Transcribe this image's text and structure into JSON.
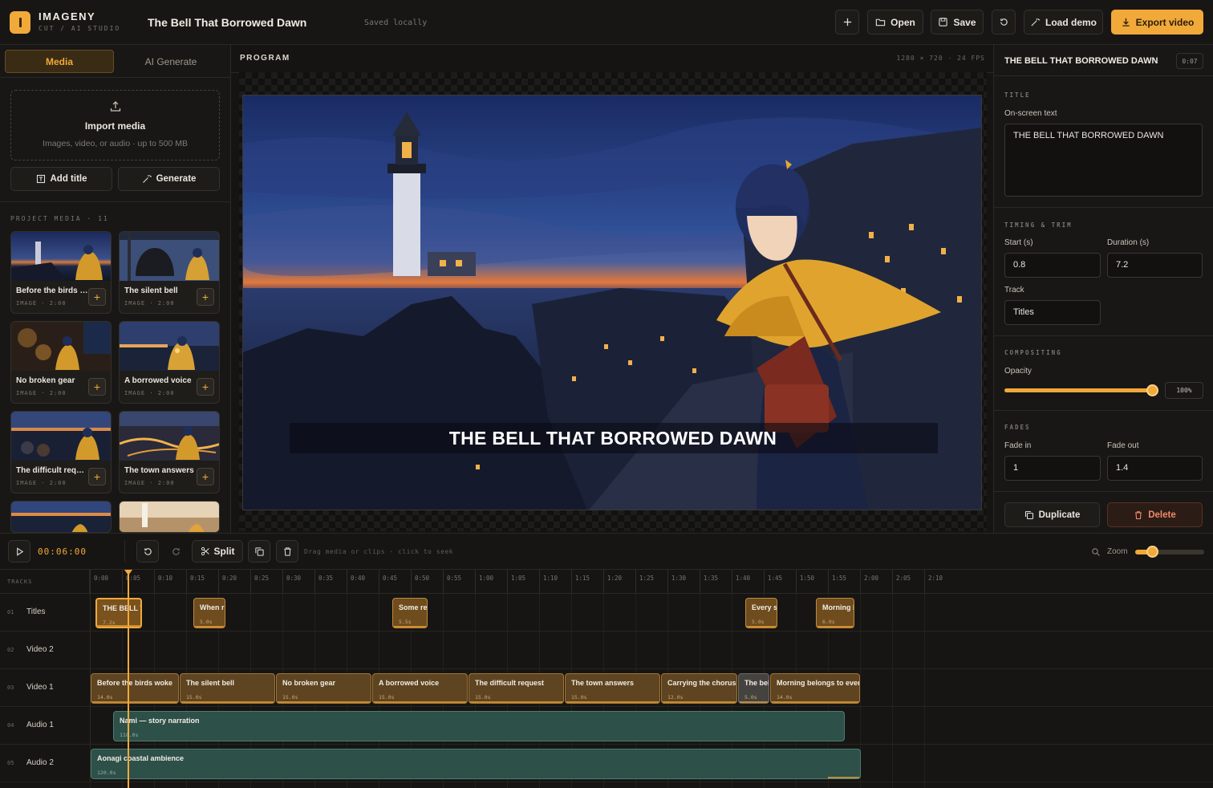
{
  "app": {
    "brand": "IMAGENY",
    "brand_sub": "CUT / AI STUDIO",
    "project_title": "The Bell That Borrowed Dawn",
    "save_status": "Saved locally"
  },
  "toolbar": {
    "open": "Open",
    "save": "Save",
    "load_demo": "Load demo",
    "export": "Export video"
  },
  "left": {
    "tabs": [
      "Media",
      "AI Generate"
    ],
    "import_title": "Import media",
    "import_sub": "Images, video, or audio · up to 500 MB",
    "add_title": "Add title",
    "generate": "Generate",
    "project_media_label": "PROJECT MEDIA · 11",
    "cards": [
      {
        "title": "Before the birds woke",
        "meta": "IMAGE · 2:00"
      },
      {
        "title": "The silent bell",
        "meta": "IMAGE · 2:00"
      },
      {
        "title": "No broken gear",
        "meta": "IMAGE · 2:00"
      },
      {
        "title": "A borrowed voice",
        "meta": "IMAGE · 2:00"
      },
      {
        "title": "The difficult request",
        "meta": "IMAGE · 2:00"
      },
      {
        "title": "The town answers",
        "meta": "IMAGE · 2:00"
      }
    ]
  },
  "program": {
    "label": "PROGRAM",
    "resolution": "1280 × 720 · 24 FPS",
    "caption": "THE BELL THAT BORROWED DAWN"
  },
  "inspector": {
    "clip_name": "THE BELL THAT BORROWED DAWN",
    "clip_duration": "0:07",
    "title_section": "TITLE",
    "onscreen_label": "On-screen text",
    "onscreen_value": "THE BELL THAT BORROWED DAWN",
    "timing_section": "TIMING & TRIM",
    "start_label": "Start (s)",
    "start_value": "0.8",
    "duration_label": "Duration (s)",
    "duration_value": "7.2",
    "track_label": "Track",
    "track_value": "Titles",
    "compositing_section": "COMPOSITING",
    "opacity_label": "Opacity",
    "opacity_value": "100%",
    "opacity_fraction": 1.0,
    "fades_section": "FADES",
    "fade_in_label": "Fade in",
    "fade_in_value": "1",
    "fade_out_label": "Fade out",
    "fade_out_value": "1.4",
    "duplicate": "Duplicate",
    "delete": "Delete"
  },
  "timeline": {
    "timecode": "00:06:00",
    "split": "Split",
    "hint": "Drag media or clips · click to seek",
    "zoom_label": "Zoom",
    "tracks_header": "TRACKS",
    "ruler": [
      "0:00",
      "0:05",
      "0:10",
      "0:15",
      "0:20",
      "0:25",
      "0:30",
      "0:35",
      "0:40",
      "0:45",
      "0:50",
      "0:55",
      "1:00",
      "1:05",
      "1:10",
      "1:15",
      "1:20",
      "1:25",
      "1:30",
      "1:35",
      "1:40",
      "1:45",
      "1:50",
      "1:55",
      "2:00",
      "2:05",
      "2:10"
    ],
    "tracks": [
      {
        "num": "01",
        "name": "Titles"
      },
      {
        "num": "02",
        "name": "Video 2"
      },
      {
        "num": "03",
        "name": "Video 1"
      },
      {
        "num": "04",
        "name": "Audio 1"
      },
      {
        "num": "05",
        "name": "Audio 2"
      }
    ],
    "title_clips": [
      {
        "name": "THE BELL T",
        "dur": "7.2s"
      },
      {
        "name": "When r",
        "dur": "5.0s"
      },
      {
        "name": "Some re",
        "dur": "5.5s"
      },
      {
        "name": "Every si",
        "dur": "5.0s"
      },
      {
        "name": "Morning l",
        "dur": "6.0s"
      }
    ],
    "video_clips": [
      {
        "name": "Before the birds woke",
        "dur": "14.0s"
      },
      {
        "name": "The silent bell",
        "dur": "15.0s"
      },
      {
        "name": "No broken gear",
        "dur": "15.0s"
      },
      {
        "name": "A borrowed voice",
        "dur": "15.0s"
      },
      {
        "name": "The difficult request",
        "dur": "15.0s"
      },
      {
        "name": "The town answers",
        "dur": "15.0s"
      },
      {
        "name": "Carrying the chorus",
        "dur": "12.0s"
      },
      {
        "name": "The bel",
        "dur": "5.0s"
      },
      {
        "name": "Morning belongs to ever",
        "dur": "14.0s"
      }
    ],
    "audio1": {
      "name": "Nami — story narration",
      "dur": "118.0s"
    },
    "audio2": {
      "name": "Aonagi coastal ambience",
      "dur": "120.0s"
    }
  }
}
